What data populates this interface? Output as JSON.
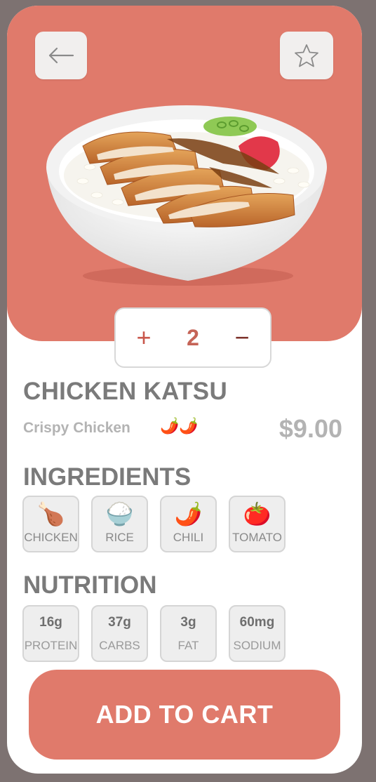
{
  "colors": {
    "accent": "#e07a6b",
    "background": "#7d7271"
  },
  "hero": {
    "image": "chicken-katsu-bowl",
    "back_icon": "arrow-left-icon",
    "favorite_icon": "star-icon"
  },
  "quantity": {
    "increment": "+",
    "value": "2",
    "decrement": "−"
  },
  "product": {
    "name": "CHICKEN KATSU",
    "subtitle": "Crispy Chicken",
    "spice": "🌶️🌶️",
    "price": "$9.00"
  },
  "ingredients": {
    "title": "INGREDIENTS",
    "items": [
      {
        "icon": "🍗",
        "label": "CHICKEN"
      },
      {
        "icon": "🍚",
        "label": "RICE"
      },
      {
        "icon": "🌶️",
        "label": "CHILI"
      },
      {
        "icon": "🍅",
        "label": "TOMATO"
      }
    ]
  },
  "nutrition": {
    "title": "NUTRITION",
    "items": [
      {
        "value": "16g",
        "label": "PROTEIN"
      },
      {
        "value": "37g",
        "label": "CARBS"
      },
      {
        "value": "3g",
        "label": "FAT"
      },
      {
        "value": "60mg",
        "label": "SODIUM"
      }
    ]
  },
  "cart": {
    "label": "ADD TO CART"
  }
}
